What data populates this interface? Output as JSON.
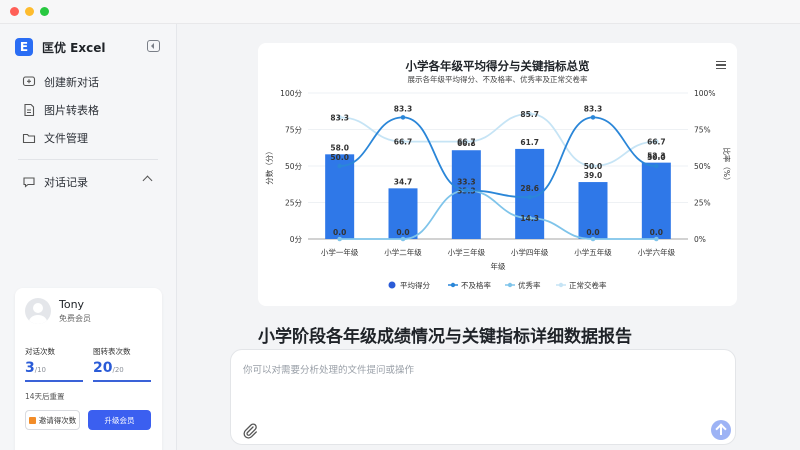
{
  "app": {
    "name": "匡优 Excel",
    "logo_letter": "E",
    "brand_color": "#2a6df4"
  },
  "sidebar": {
    "items": [
      {
        "label": "创建新对话",
        "icon": "chat-plus-icon"
      },
      {
        "label": "图片转表格",
        "icon": "image-icon"
      },
      {
        "label": "文件管理",
        "icon": "folder-icon"
      },
      {
        "label": "对话记录",
        "icon": "chat-icon"
      }
    ]
  },
  "user": {
    "name": "Tony",
    "tier": "免费会员",
    "chat_label": "对话次数",
    "chat_used": "3",
    "chat_total": "/10",
    "img_label": "图转表次数",
    "img_used": "20",
    "img_total": "/20",
    "reset_text": "14天后重置",
    "invite_label": "邀请得次数",
    "upgrade_label": "升级会员"
  },
  "chart_data": {
    "type": "bar",
    "title": "小学各年级平均得分与关键指标总览",
    "subtitle": "展示各年级平均得分、不及格率、优秀率及正常交卷率",
    "xlabel": "年级",
    "ylabel": "分数（分）",
    "y2label": "比率（%）",
    "categories": [
      "小学一年级",
      "小学二年级",
      "小学三年级",
      "小学四年级",
      "小学五年级",
      "小学六年级"
    ],
    "ylim": [
      0,
      100
    ],
    "yticks": [
      "0分",
      "25分",
      "50分",
      "75分",
      "100分"
    ],
    "y2ticks": [
      "0%",
      "25%",
      "50%",
      "75%",
      "100%"
    ],
    "series": [
      {
        "name": "平均得分",
        "type": "bar",
        "color": "#2f78e8",
        "values": [
          58.0,
          34.7,
          60.8,
          61.7,
          39.0,
          52.3
        ]
      },
      {
        "name": "不及格率",
        "type": "line",
        "color": "#2a86d8",
        "values": [
          50.0,
          83.3,
          33.3,
          28.6,
          83.3,
          50.0
        ]
      },
      {
        "name": "优秀率",
        "type": "line",
        "color": "#7fc4ea",
        "values": [
          0.0,
          0.0,
          33.3,
          14.3,
          0.0,
          0.0
        ]
      },
      {
        "name": "正常交卷率",
        "type": "line",
        "color": "#c6e4f5",
        "values": [
          83.3,
          66.7,
          66.7,
          85.7,
          50.0,
          66.7
        ]
      }
    ],
    "annotations": {
      "优秀率": "优秀率",
      "正常交卷率": "正常交卷率"
    }
  },
  "report_title": "小学阶段各年级成绩情况与关键指标详细数据报告",
  "input": {
    "placeholder": "你可以对需要分析处理的文件提问或操作"
  }
}
